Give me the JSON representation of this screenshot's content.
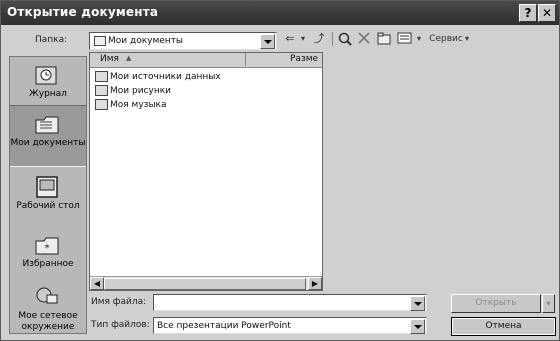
{
  "window": {
    "title": "Открытие документа",
    "help_label": "?",
    "close_label": "✕"
  },
  "toolbar": {
    "look_in_label": "Папка:",
    "look_in_value": "Мои документы",
    "back_label": "⇐",
    "up_label": "⤴",
    "service_label": "Сервис"
  },
  "places": [
    {
      "label": "Журнал",
      "icon": "history-icon"
    },
    {
      "label": "Мои документы",
      "icon": "my-documents-icon"
    },
    {
      "label": "Рабочий стол",
      "icon": "desktop-icon"
    },
    {
      "label": "Избранное",
      "icon": "favorites-icon"
    },
    {
      "label": "Мое сетевое окружение",
      "icon": "network-icon"
    }
  ],
  "list": {
    "columns": [
      "Имя",
      "Разме"
    ],
    "items": [
      "Мои источники данных",
      "Мои рисунки",
      "Моя музыка"
    ]
  },
  "filename": {
    "label": "Имя файла:",
    "value": ""
  },
  "filetype": {
    "label": "Тип файлов:",
    "value": "Все презентации PowerPoint"
  },
  "buttons": {
    "open_label": "Открыть",
    "cancel_label": "Отмена"
  }
}
